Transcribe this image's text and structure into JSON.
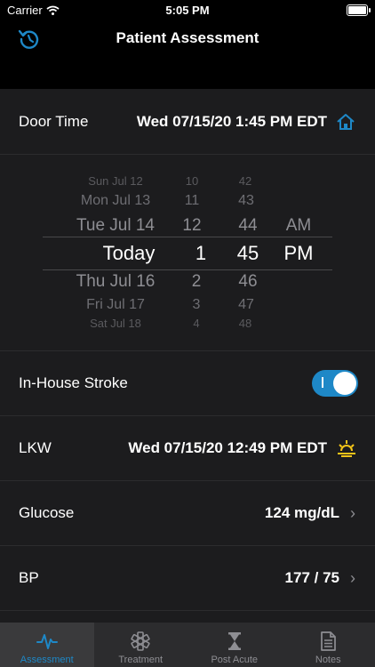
{
  "status": {
    "carrier": "Carrier",
    "time": "5:05 PM"
  },
  "nav": {
    "title": "Patient Assessment"
  },
  "door_time": {
    "label": "Door Time",
    "value": "Wed 07/15/20 1:45 PM EDT"
  },
  "picker": {
    "days": [
      "Sun Jul 12",
      "Mon Jul 13",
      "Tue Jul 14",
      "Today",
      "Thu Jul 16",
      "Fri Jul 17",
      "Sat Jul 18"
    ],
    "hours": [
      "10",
      "11",
      "12",
      "1",
      "2",
      "3",
      "4"
    ],
    "minutes": [
      "42",
      "43",
      "44",
      "45",
      "46",
      "47",
      "48"
    ],
    "ampm": [
      "AM",
      "PM"
    ]
  },
  "in_house": {
    "label": "In-House Stroke",
    "on": true
  },
  "lkw": {
    "label": "LKW",
    "value": "Wed 07/15/20 12:49 PM EDT"
  },
  "glucose": {
    "label": "Glucose",
    "value": "124 mg/dL"
  },
  "bp": {
    "label": "BP",
    "value": "177 / 75"
  },
  "tabs": [
    {
      "label": "Assessment",
      "icon": "pulse-icon"
    },
    {
      "label": "Treatment",
      "icon": "star-of-life-icon"
    },
    {
      "label": "Post Acute",
      "icon": "hourglass-icon"
    },
    {
      "label": "Notes",
      "icon": "document-icon"
    }
  ],
  "colors": {
    "accent": "#1e88c7",
    "sun": "#f5c518",
    "background": "#1c1c1e"
  }
}
